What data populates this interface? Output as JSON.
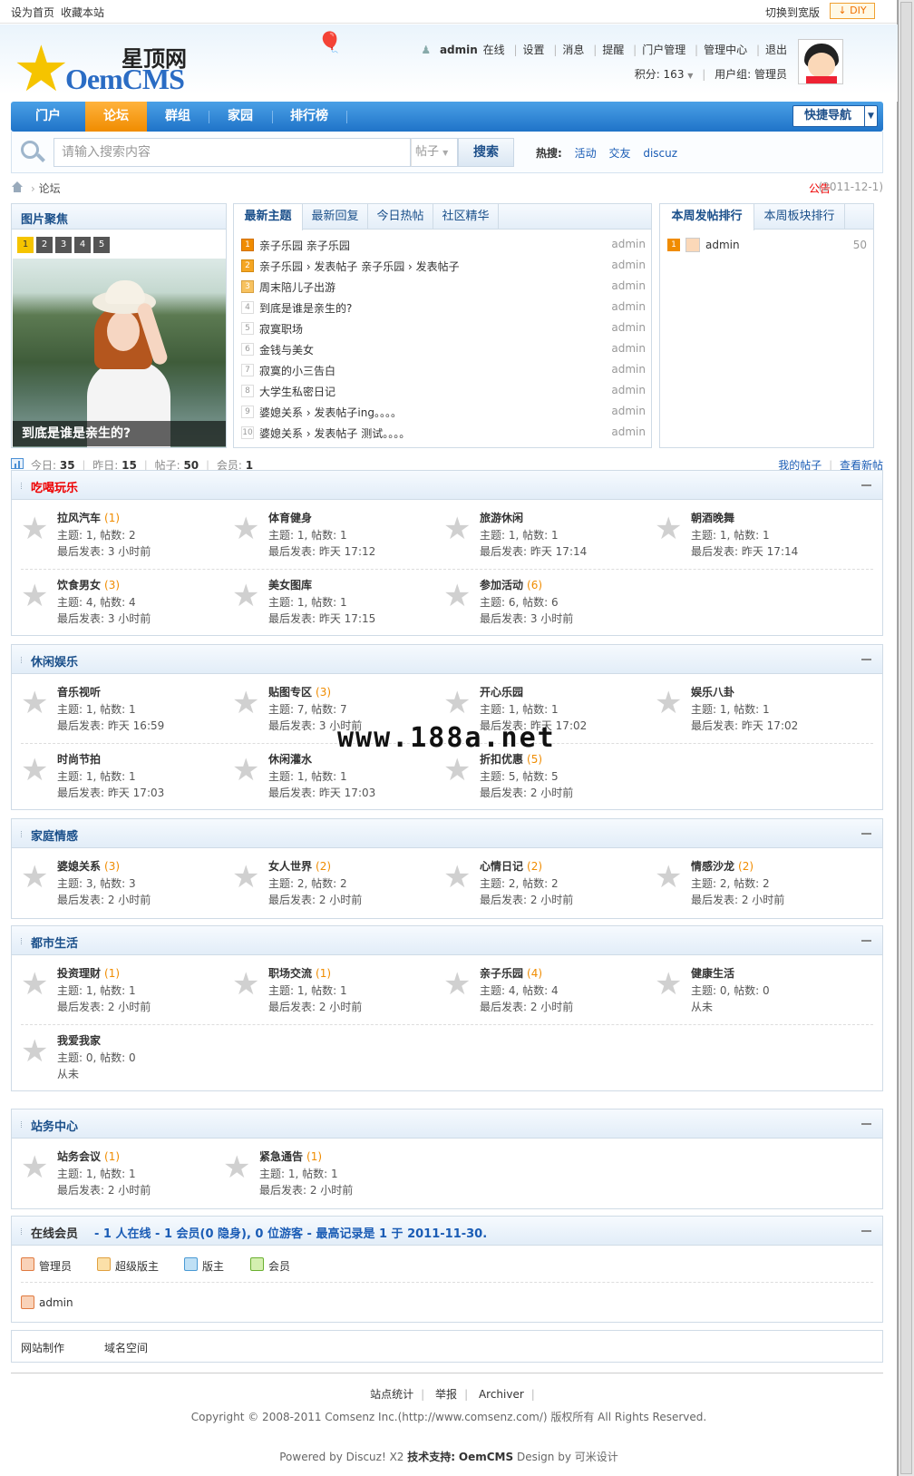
{
  "topbar": {
    "set_home": "设为首页",
    "favorite": "收藏本站",
    "switch_width": "切换到宽版",
    "diy": "DIY"
  },
  "logo": {
    "site_name": "星顶网",
    "brand": "OemCMS"
  },
  "user": {
    "name": "admin",
    "status": "在线",
    "links": [
      "设置",
      "消息",
      "提醒",
      "门户管理",
      "管理中心",
      "退出"
    ],
    "points_label": "积分: 163",
    "group_label": "用户组: 管理员"
  },
  "nav": {
    "items": [
      "门户",
      "论坛",
      "群组",
      "家园",
      "排行榜"
    ],
    "active": "论坛",
    "quick_nav": "快捷导航"
  },
  "search": {
    "placeholder": "请输入搜索内容",
    "type": "帖子",
    "button": "搜索",
    "hot_label": "热搜:",
    "hot_words": [
      "活动",
      "交友",
      "discuz"
    ]
  },
  "breadcrumb": {
    "current": "论坛",
    "notice": "公告",
    "notice_date": "(2011-12-1)"
  },
  "slideshow": {
    "title": "图片聚焦",
    "pages": [
      "1",
      "2",
      "3",
      "4",
      "5"
    ],
    "caption": "到底是谁是亲生的?"
  },
  "threads": {
    "tabs": [
      "最新主题",
      "最新回复",
      "今日热帖",
      "社区精华"
    ],
    "items": [
      {
        "n": "1",
        "title": "亲子乐园 亲子乐园",
        "author": "admin"
      },
      {
        "n": "2",
        "title": "亲子乐园 › 发表帖子 亲子乐园 › 发表帖子",
        "author": "admin"
      },
      {
        "n": "3",
        "title": "周末陪儿子出游",
        "author": "admin"
      },
      {
        "n": "4",
        "title": "到底是谁是亲生的?",
        "author": "admin"
      },
      {
        "n": "5",
        "title": "寂寞职场",
        "author": "admin"
      },
      {
        "n": "6",
        "title": "金钱与美女",
        "author": "admin"
      },
      {
        "n": "7",
        "title": "寂寞的小三告白",
        "author": "admin"
      },
      {
        "n": "8",
        "title": "大学生私密日记",
        "author": "admin"
      },
      {
        "n": "9",
        "title": "婆媳关系 › 发表帖子ing。。。。",
        "author": "admin"
      },
      {
        "n": "10",
        "title": "婆媳关系 › 发表帖子 测试。。。。",
        "author": "admin"
      }
    ]
  },
  "ranking": {
    "tabs": [
      "本周发帖排行",
      "本周板块排行"
    ],
    "items": [
      {
        "n": "1",
        "name": "admin",
        "count": "50"
      }
    ]
  },
  "stats": {
    "today_label": "今日:",
    "today": "35",
    "yesterday_label": "昨日:",
    "yesterday": "15",
    "posts_label": "帖子:",
    "posts": "50",
    "members_label": "会员:",
    "members": "1",
    "my_posts": "我的帖子",
    "new_posts": "查看新帖"
  },
  "categories": [
    {
      "title": "吃喝玩乐",
      "forums": [
        {
          "name": "拉风汽车",
          "count": "(1)",
          "stat": "主题: 1, 帖数: 2",
          "last": "最后发表: 3 小时前"
        },
        {
          "name": "体育健身",
          "count": "",
          "stat": "主题: 1, 帖数: 1",
          "last": "最后发表: 昨天 17:12"
        },
        {
          "name": "旅游休闲",
          "count": "",
          "stat": "主题: 1, 帖数: 1",
          "last": "最后发表: 昨天 17:14"
        },
        {
          "name": "朝酒晚舞",
          "count": "",
          "stat": "主题: 1, 帖数: 1",
          "last": "最后发表: 昨天 17:14"
        },
        {
          "name": "饮食男女",
          "count": "(3)",
          "stat": "主题: 4, 帖数: 4",
          "last": "最后发表: 3 小时前"
        },
        {
          "name": "美女图库",
          "count": "",
          "stat": "主题: 1, 帖数: 1",
          "last": "最后发表: 昨天 17:15"
        },
        {
          "name": "参加活动",
          "count": "(6)",
          "stat": "主题: 6, 帖数: 6",
          "last": "最后发表: 3 小时前"
        }
      ]
    },
    {
      "title": "休闲娱乐",
      "forums": [
        {
          "name": "音乐视听",
          "count": "",
          "stat": "主题: 1, 帖数: 1",
          "last": "最后发表: 昨天 16:59"
        },
        {
          "name": "贴图专区",
          "count": "(3)",
          "stat": "主题: 7, 帖数: 7",
          "last": "最后发表: 3 小时前"
        },
        {
          "name": "开心乐园",
          "count": "",
          "stat": "主题: 1, 帖数: 1",
          "last": "最后发表: 昨天 17:02"
        },
        {
          "name": "娱乐八卦",
          "count": "",
          "stat": "主题: 1, 帖数: 1",
          "last": "最后发表: 昨天 17:02"
        },
        {
          "name": "时尚节拍",
          "count": "",
          "stat": "主题: 1, 帖数: 1",
          "last": "最后发表: 昨天 17:03"
        },
        {
          "name": "休闲灌水",
          "count": "",
          "stat": "主题: 1, 帖数: 1",
          "last": "最后发表: 昨天 17:03"
        },
        {
          "name": "折扣优惠",
          "count": "(5)",
          "stat": "主题: 5, 帖数: 5",
          "last": "最后发表: 2 小时前"
        }
      ]
    },
    {
      "title": "家庭情感",
      "forums": [
        {
          "name": "婆媳关系",
          "count": "(3)",
          "stat": "主题: 3, 帖数: 3",
          "last": "最后发表: 2 小时前"
        },
        {
          "name": "女人世界",
          "count": "(2)",
          "stat": "主题: 2, 帖数: 2",
          "last": "最后发表: 2 小时前"
        },
        {
          "name": "心情日记",
          "count": "(2)",
          "stat": "主题: 2, 帖数: 2",
          "last": "最后发表: 2 小时前"
        },
        {
          "name": "情感沙龙",
          "count": "(2)",
          "stat": "主题: 2, 帖数: 2",
          "last": "最后发表: 2 小时前"
        }
      ]
    },
    {
      "title": "都市生活",
      "forums": [
        {
          "name": "投资理财",
          "count": "(1)",
          "stat": "主题: 1, 帖数: 1",
          "last": "最后发表: 2 小时前"
        },
        {
          "name": "职场交流",
          "count": "(1)",
          "stat": "主题: 1, 帖数: 1",
          "last": "最后发表: 2 小时前"
        },
        {
          "name": "亲子乐园",
          "count": "(4)",
          "stat": "主题: 4, 帖数: 4",
          "last": "最后发表: 2 小时前"
        },
        {
          "name": "健康生活",
          "count": "",
          "stat": "主题: 0, 帖数: 0",
          "last": "从未"
        },
        {
          "name": "我爱我家",
          "count": "",
          "stat": "主题: 0, 帖数: 0",
          "last": "从未"
        }
      ]
    },
    {
      "title": "站务中心",
      "forums": [
        {
          "name": "站务会议",
          "count": "(1)",
          "stat": "主题: 1, 帖数: 1",
          "last": "最后发表: 2 小时前"
        },
        {
          "name": "紧急通告",
          "count": "(1)",
          "stat": "主题: 1, 帖数: 1",
          "last": "最后发表: 2 小时前"
        }
      ]
    }
  ],
  "online": {
    "label": "在线会员",
    "info": "- 1 人在线  - 1 会员(0 隐身), 0 位游客  - 最高记录是  1 于  2011-11-30.",
    "legend": [
      "管理员",
      "超级版主",
      "版主",
      "会员"
    ],
    "members": [
      "admin"
    ]
  },
  "friend_links": [
    "网站制作",
    "域名空间"
  ],
  "footer": {
    "links": [
      "站点统计",
      "举报",
      "Archiver"
    ],
    "copyright": "Copyright © 2008-2011 Comsenz Inc.(http://www.comsenz.com/) 版权所有  All Rights Reserved.",
    "powered_prefix": "Powered by Discuz! X2",
    "support_label": "技术支持:",
    "support_brand": "OemCMS",
    "design": "Design by 可米设计"
  },
  "watermark": "www.188a.net",
  "colors": {
    "nav_blue": "#1f73c8",
    "nav_active": "#f08c00",
    "link_blue": "#1a5cb5",
    "category_title_hot": "#e00000"
  }
}
